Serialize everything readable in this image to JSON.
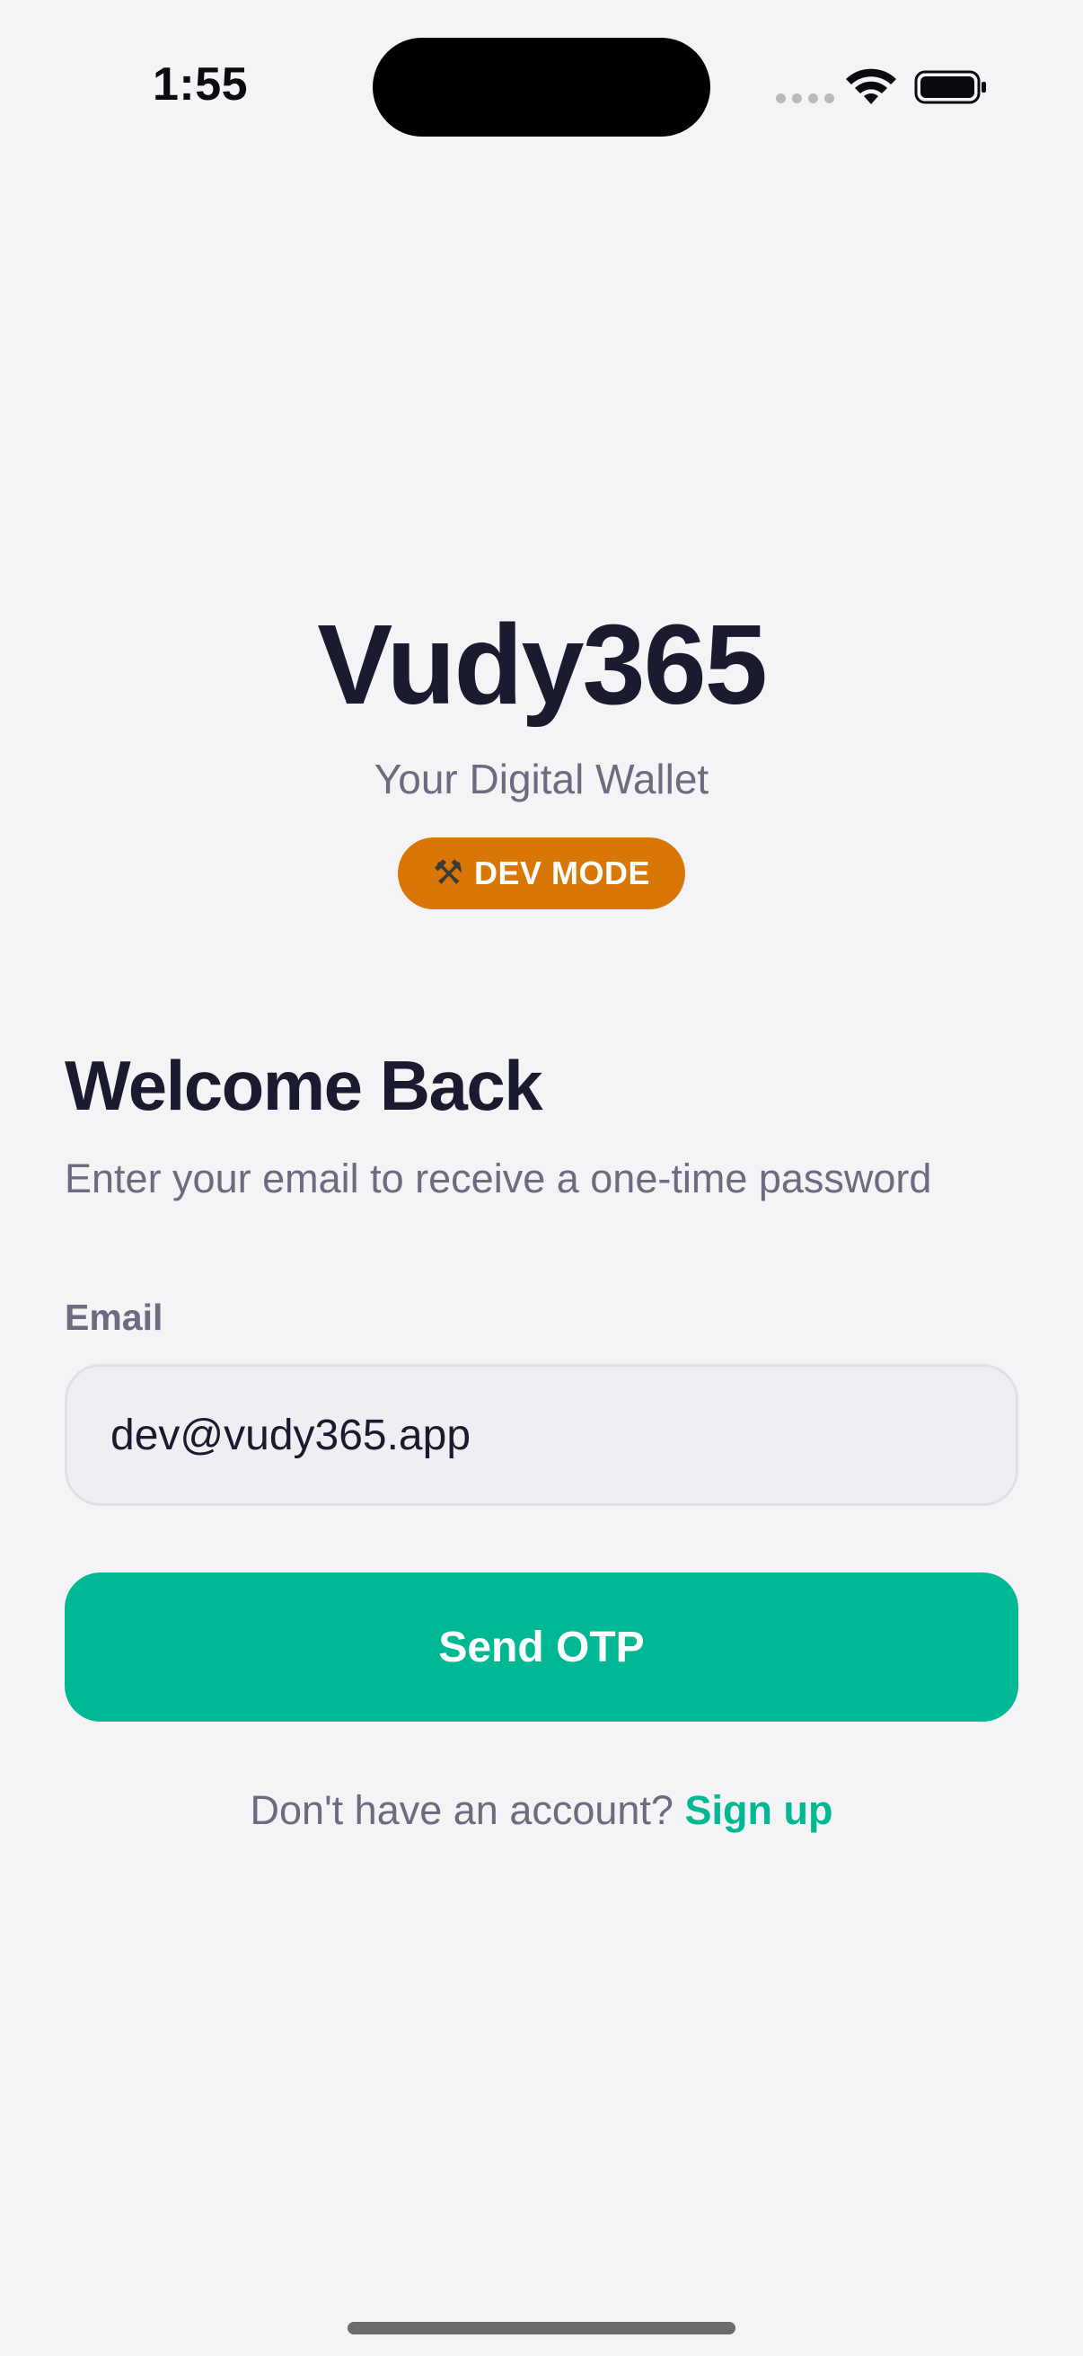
{
  "status_bar": {
    "time": "1:55",
    "icons": [
      "cellular-signal-icon",
      "wifi-icon",
      "battery-icon"
    ]
  },
  "brand": {
    "title": "Vudy365",
    "subtitle": "Your Digital Wallet",
    "badge_icon": "hammer-and-wrench-icon",
    "badge_glyph": "⚒",
    "badge_label": "DEV MODE",
    "badge_color": "#d97706"
  },
  "login": {
    "heading": "Welcome Back",
    "description": "Enter your email to receive a one-time password",
    "email_label": "Email",
    "email_value": "dev@vudy365.app",
    "submit_label": "Send OTP",
    "signup_prompt": "Don't have an account?",
    "signup_link": "Sign up"
  },
  "colors": {
    "background": "#f4f4f7",
    "accent": "#00b894",
    "text_primary": "#1a1b2f",
    "text_secondary": "#6b6c80"
  }
}
